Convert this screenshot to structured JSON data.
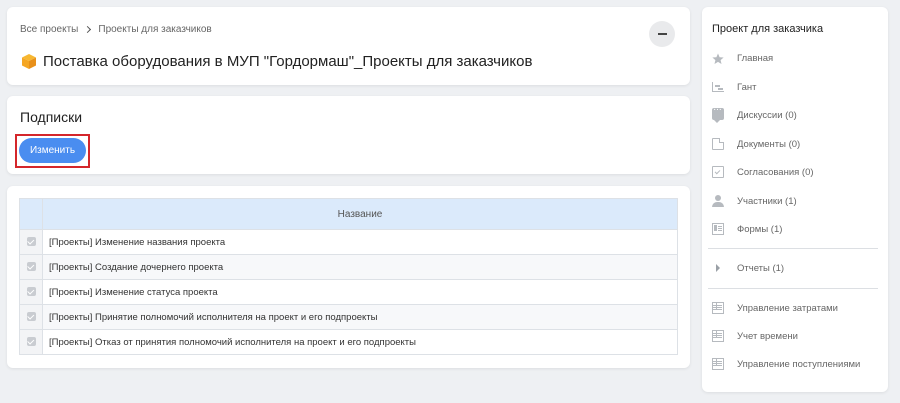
{
  "breadcrumb": {
    "root": "Все проекты",
    "current": "Проекты для заказчиков"
  },
  "page": {
    "title": "Поставка оборудования в МУП \"Гордормаш\"_Проекты для заказчиков",
    "icon": "cube-icon"
  },
  "subscriptions": {
    "title": "Подписки",
    "edit_label": "Изменить"
  },
  "table": {
    "header_name": "Название",
    "rows": [
      "[Проекты] Изменение названия проекта",
      "[Проекты] Создание дочернего проекта",
      "[Проекты] Изменение статуса проекта",
      "[Проекты] Принятие полномочий исполнителя на проект и его подпроекты",
      "[Проекты] Отказ от принятия полномочий исполнителя на проект и его подпроекты"
    ]
  },
  "sidebar": {
    "title": "Проект для заказчика",
    "items": [
      {
        "label": "Главная",
        "icon": "star-icon"
      },
      {
        "label": "Гант",
        "icon": "gantt-icon"
      },
      {
        "label": "Дискуссии (0)",
        "icon": "chat-icon"
      },
      {
        "label": "Документы (0)",
        "icon": "document-icon"
      },
      {
        "label": "Согласования (0)",
        "icon": "approval-icon"
      },
      {
        "label": "Участники (1)",
        "icon": "user-icon"
      },
      {
        "label": "Формы (1)",
        "icon": "form-icon"
      },
      {
        "label": "Отчеты (1)",
        "icon": "caret-right-icon"
      },
      {
        "label": "Управление затратами",
        "icon": "table-icon"
      },
      {
        "label": "Учет времени",
        "icon": "table-icon"
      },
      {
        "label": "Управление поступлениями",
        "icon": "table-icon"
      }
    ]
  },
  "colors": {
    "accent": "#4a8df0",
    "highlight": "#d4262b",
    "table_header": "#dbeafb",
    "icon_orange": "#f5a623"
  }
}
